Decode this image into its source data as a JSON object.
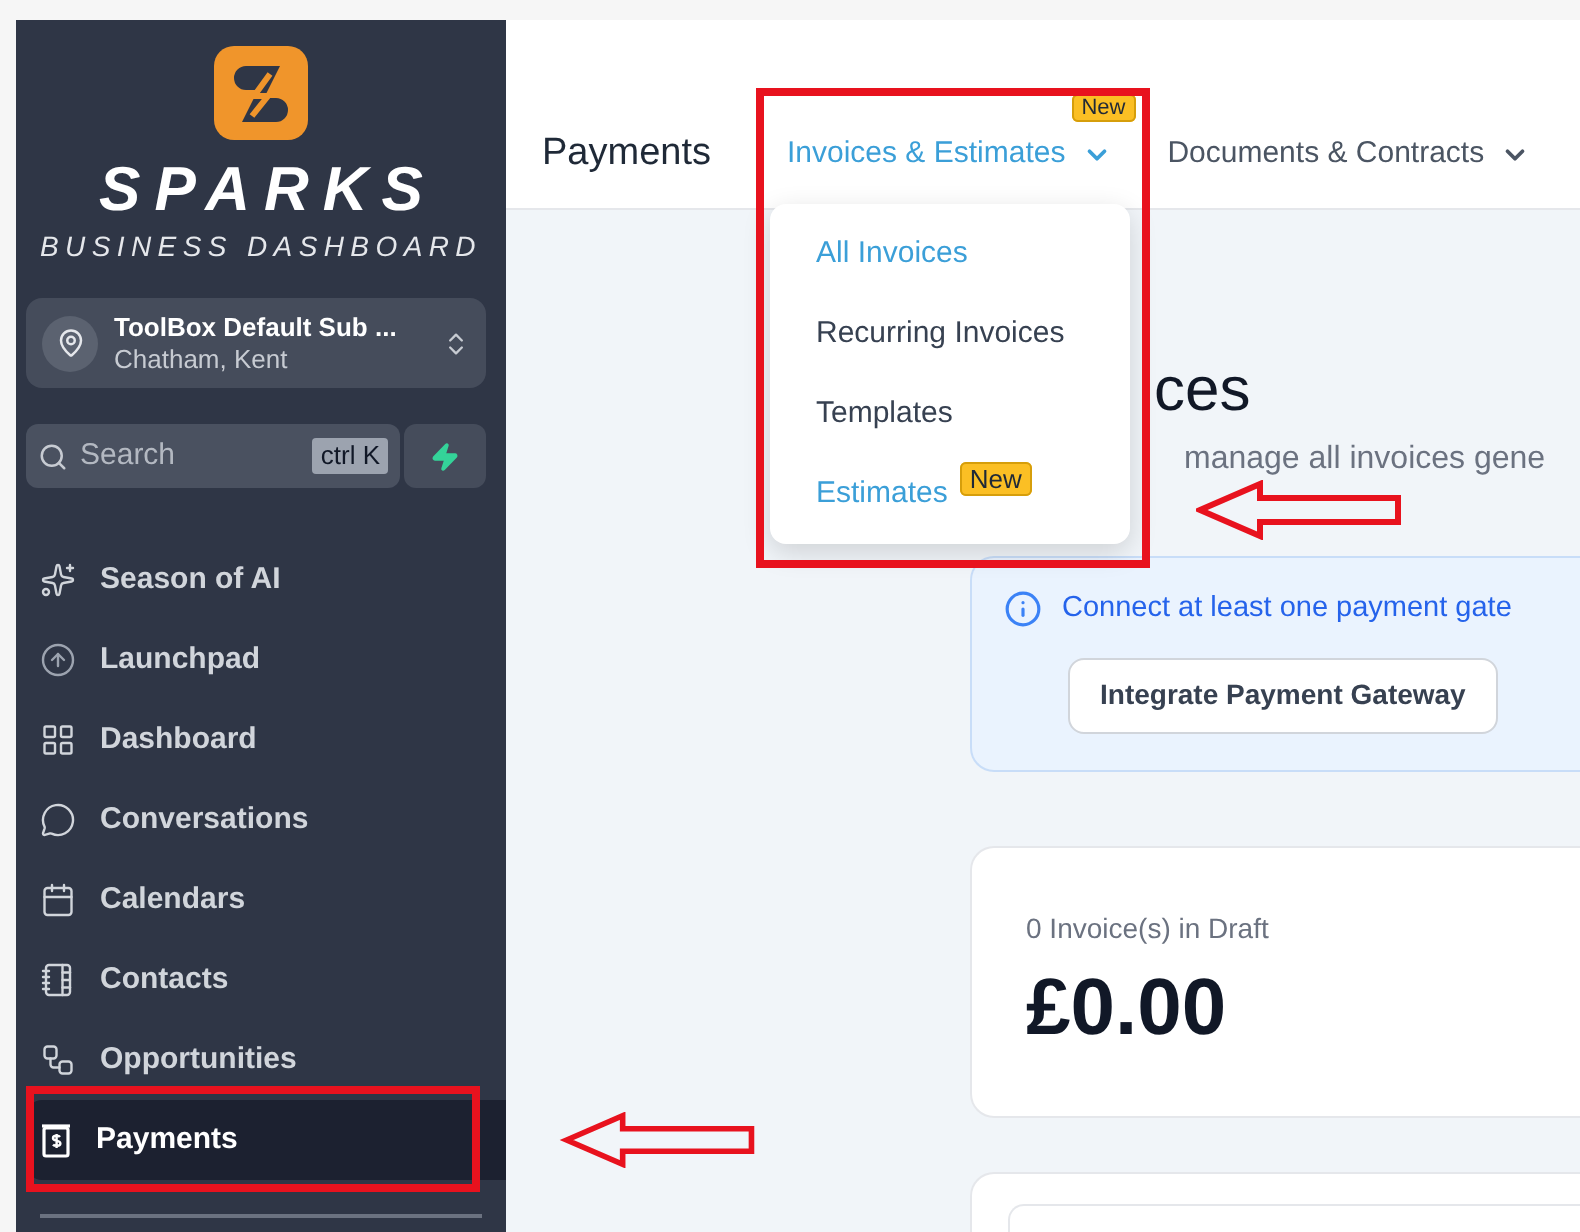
{
  "brand": {
    "name": "SPARKS",
    "tagline": "BUSINESS DASHBOARD"
  },
  "location": {
    "name": "ToolBox Default Sub ...",
    "address": "Chatham, Kent"
  },
  "search": {
    "placeholder": "Search",
    "shortcut": "ctrl K"
  },
  "sidebar": {
    "items": [
      {
        "label": "Season of AI",
        "selected": false
      },
      {
        "label": "Launchpad",
        "selected": false
      },
      {
        "label": "Dashboard",
        "selected": false
      },
      {
        "label": "Conversations",
        "selected": false
      },
      {
        "label": "Calendars",
        "selected": false
      },
      {
        "label": "Contacts",
        "selected": false
      },
      {
        "label": "Opportunities",
        "selected": false
      },
      {
        "label": "Payments",
        "selected": true
      }
    ]
  },
  "top_nav": {
    "title": "Payments",
    "tabs": [
      {
        "label": "Invoices & Estimates",
        "selected": true,
        "badge": "New"
      },
      {
        "label": "Documents & Contracts",
        "selected": false
      }
    ]
  },
  "dropdown": {
    "items": [
      {
        "label": "All Invoices",
        "selected": true
      },
      {
        "label": "Recurring Invoices",
        "selected": false
      },
      {
        "label": "Templates",
        "selected": false
      },
      {
        "label": "Estimates",
        "selected": true,
        "badge": "New"
      }
    ]
  },
  "page": {
    "heading": "ces",
    "subtitle": "manage all invoices gene"
  },
  "banner": {
    "message": "Connect at least one payment gate",
    "button": "Integrate Payment Gateway"
  },
  "summary_card": {
    "label": "0 Invoice(s) in Draft",
    "amount": "£0.00"
  },
  "annotations": [
    {
      "kind": "frame"
    },
    {
      "kind": "arrow"
    },
    {
      "kind": "frame"
    },
    {
      "kind": "arrow"
    }
  ]
}
